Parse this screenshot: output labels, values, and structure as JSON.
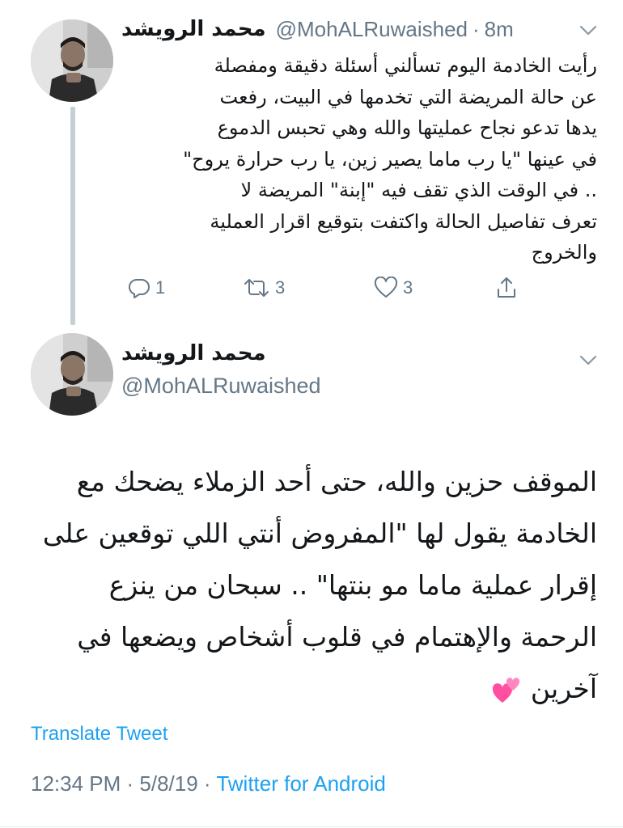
{
  "tweet1": {
    "author_name": "محمد الرويشد",
    "handle": "@MohALRuwaished",
    "separator": "·",
    "time": "8m",
    "text_lines": [
      "رأيت الخادمة اليوم تسألني أسئلة دقيقة ومفصلة",
      "عن حالة المريضة التي تخدمها في البيت، رفعت",
      "يدها تدعو نجاح عمليتها والله وهي تحبس الدموع",
      "في عينها \"يا رب ماما يصير زين، يا رب حرارة يروح\"",
      ".. في الوقت الذي تقف فيه \"إبنة\" المريضة لا",
      "تعرف تفاصيل الحالة واكتفت بتوقيع اقرار العملية",
      "والخروج"
    ],
    "actions": {
      "reply_count": "1",
      "retweet_count": "3",
      "like_count": "3"
    }
  },
  "tweet2": {
    "author_name": "محمد الرويشد",
    "handle": "@MohALRuwaished",
    "text_lines": [
      "الموقف حزين والله، حتى أحد الزملاء يضحك مع",
      "الخادمة يقول لها \"المفروض أنتي اللي توقعين على",
      "إقرار عملية ماما مو بنتها\" .. سبحان من ينزع",
      "الرحمة والإهتمام في قلوب أشخاص ويضعها في",
      "آخرين"
    ],
    "emoji": "two-hearts",
    "translate_label": "Translate Tweet",
    "timestamp": "12:34 PM · 5/8/19 · ",
    "source": "Twitter for Android"
  },
  "colors": {
    "accent": "#1da1f2",
    "muted": "#657786",
    "text": "#14171a",
    "thread_line": "#c4cfd6",
    "heart_emoji": "#ff5fa8"
  }
}
